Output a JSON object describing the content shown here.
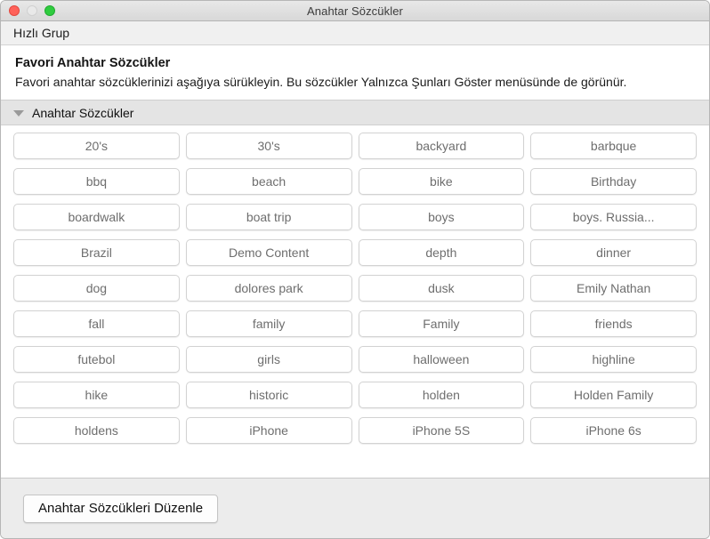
{
  "window": {
    "title": "Anahtar Sözcükler",
    "controls": {
      "close": "close-button",
      "minimize": "minimize-button",
      "zoom": "zoom-button"
    }
  },
  "toolbar": {
    "label": "Hızlı Grup"
  },
  "intro": {
    "title": "Favori Anahtar Sözcükler",
    "body": "Favori anahtar sözcüklerinizi aşağıya sürükleyin. Bu sözcükler Yalnızca Şunları Göster menüsünde de görünür."
  },
  "section": {
    "title": "Anahtar Sözcükler",
    "disclosure_icon": "triangle-down-icon",
    "expanded": true
  },
  "keywords": [
    "20's",
    "30's",
    "backyard",
    "barbque",
    "bbq",
    "beach",
    "bike",
    "Birthday",
    "boardwalk",
    "boat trip",
    "boys",
    "boys. Russia...",
    "Brazil",
    "Demo Content",
    "depth",
    "dinner",
    "dog",
    "dolores park",
    "dusk",
    "Emily Nathan",
    "fall",
    "family",
    "Family",
    "friends",
    "futebol",
    "girls",
    "halloween",
    "highline",
    "hike",
    "historic",
    "holden",
    "Holden Family",
    "holdens",
    "iPhone",
    "iPhone 5S",
    "iPhone 6s"
  ],
  "footer": {
    "edit_button_label": "Anahtar Sözcükleri Düzenle"
  },
  "colors": {
    "titlebar_top": "#e8e8e8",
    "titlebar_bottom": "#d8d8d8",
    "toolbar_bg": "#f0f0f0",
    "section_header_bg": "#e4e4e4",
    "footer_bg": "#ececec",
    "keyword_text": "#6e6e6e",
    "close_red": "#ff6159",
    "minimize_gray": "#e9e9e9",
    "zoom_green": "#2fcc3f"
  }
}
